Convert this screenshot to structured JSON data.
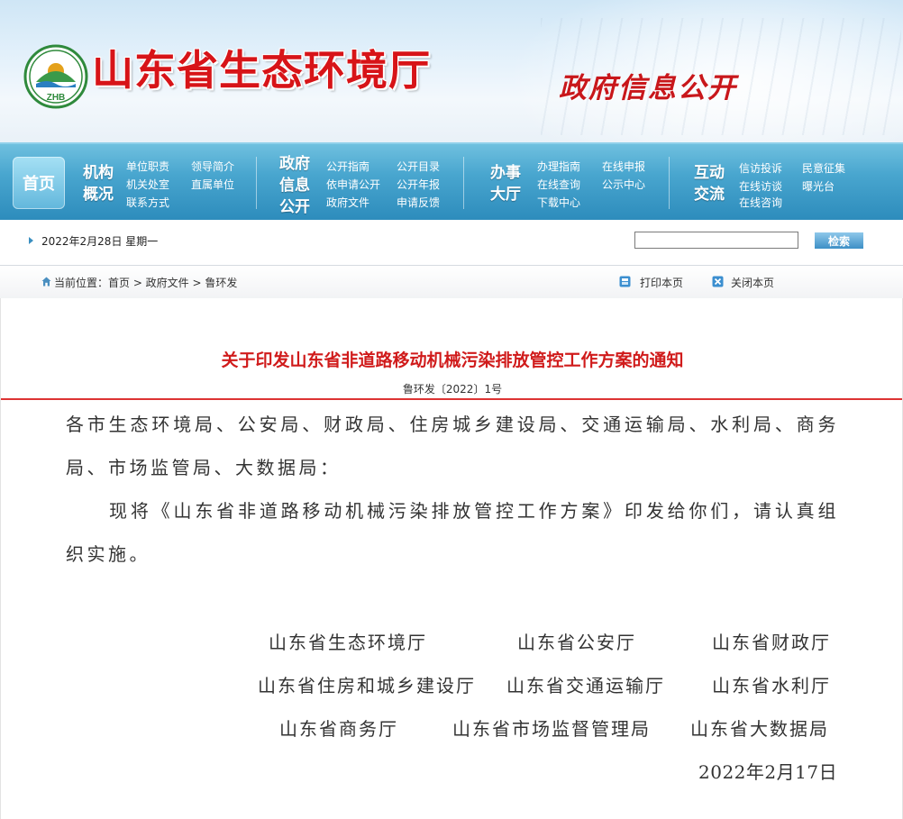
{
  "header": {
    "site_title": "山东省生态环境厅",
    "gov_info": "政府信息公开",
    "logo_text": "ZHB"
  },
  "nav": {
    "home": "首页",
    "groups": [
      {
        "heading": [
          "机构",
          "概况"
        ],
        "links": [
          "单位职责",
          "机关处室",
          "联系方式",
          "领导简介",
          "直属单位"
        ]
      },
      {
        "heading": [
          "政府",
          "信息",
          "公开"
        ],
        "links": [
          "公开指南",
          "依申请公开",
          "政府文件",
          "公开目录",
          "公开年报",
          "申请反馈"
        ]
      },
      {
        "heading": [
          "办事",
          "大厅"
        ],
        "links": [
          "办理指南",
          "在线查询",
          "下载中心",
          "在线申报",
          "公示中心"
        ]
      },
      {
        "heading": [
          "互动",
          "交流"
        ],
        "links": [
          "信访投诉",
          "在线访谈",
          "在线咨询",
          "民意征集",
          "曝光台"
        ]
      }
    ]
  },
  "datebar": {
    "date": "2022年2月28日 星期一",
    "search_placeholder": "",
    "search_button": "检索"
  },
  "breadcrumb": {
    "text": "当前位置：首页 > 政府文件 > 鲁环发",
    "print": "打印本页",
    "close": "关闭本页"
  },
  "document": {
    "title": "关于印发山东省非道路移动机械污染排放管控工作方案的通知",
    "number": "鲁环发〔2022〕1号",
    "addressee": "各市生态环境局、公安局、财政局、住房城乡建设局、交通运输局、水利局、商务局、市场监管局、大数据局：",
    "body": "现将《山东省非道路移动机械污染排放管控工作方案》印发给你们，请认真组织实施。",
    "signatories": [
      [
        "山东省生态环境厅",
        "山东省公安厅",
        "山东省财政厅"
      ],
      [
        "山东省住房和城乡建设厅",
        "山东省交通运输厅",
        "山东省水利厅"
      ],
      [
        "山东省商务厅",
        "山东省市场监督管理局",
        "山东省大数据局"
      ]
    ],
    "date": "2022年2月17日"
  },
  "colors": {
    "title_red": "#d01b1b",
    "nav_blue": "#3a9cc9"
  }
}
